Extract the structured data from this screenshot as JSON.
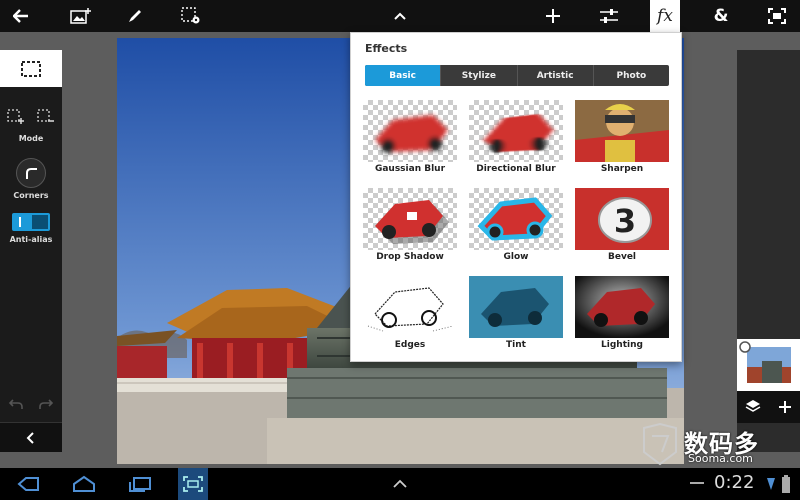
{
  "toolbar": {
    "icons": [
      "back-arrow-icon",
      "add-image-icon",
      "brush-icon",
      "selection-settings-icon",
      "chevron-up-icon",
      "crosshair-icon",
      "adjustments-icon",
      "fx-icon",
      "ampersand-icon",
      "fit-screen-icon"
    ],
    "fx_label": "fx",
    "ampersand_label": "&"
  },
  "left_panel": {
    "mode_label": "Mode",
    "corners_label": "Corners",
    "antialias_label": "Anti-alias"
  },
  "effects": {
    "title": "Effects",
    "tabs": [
      {
        "label": "Basic",
        "active": true
      },
      {
        "label": "Stylize",
        "active": false
      },
      {
        "label": "Artistic",
        "active": false
      },
      {
        "label": "Photo",
        "active": false
      }
    ],
    "items": [
      {
        "label": "Gaussian Blur"
      },
      {
        "label": "Directional Blur"
      },
      {
        "label": "Sharpen"
      },
      {
        "label": "Drop Shadow"
      },
      {
        "label": "Glow"
      },
      {
        "label": "Bevel"
      },
      {
        "label": "Edges"
      },
      {
        "label": "Tint"
      },
      {
        "label": "Lighting"
      }
    ]
  },
  "status": {
    "clock": "0:22"
  },
  "watermark": {
    "main": "数码多",
    "sub": "Sooma.com"
  },
  "colors": {
    "accent": "#1c9ad9",
    "toolbar_bg": "#111111",
    "workspace_bg": "#5d5d5d"
  }
}
